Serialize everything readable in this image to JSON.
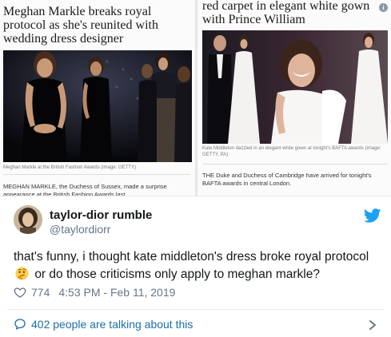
{
  "news": {
    "left": {
      "headline": "Meghan Markle breaks royal protocol as she's reunited with wedding dress designer",
      "caption": "Meghan Markle at the British Fashion Awards (image: GETTY)",
      "snippet": "MEGHAN MARKLE, the Duchess of Sussex, made a surprise appearance at the British Fashion Awards last"
    },
    "right": {
      "headline": "red carpet in elegant white gown with Prince William",
      "caption": "Kate Middleton dazzled in an elegant white gown at tonight's BAFTA awards (image: GETTY, PA)",
      "snippet": "THE Duke and Duchess of Cambridge have arrived for tonight's BAFTA awards in central London."
    },
    "info_icon": "info-icon"
  },
  "tweet": {
    "display_name": "taylor-dior rumble",
    "handle": "@taylordiorr",
    "text_before_emoji": "that's funny, i thought kate middleton's dress broke royal protocol",
    "emoji": "thinking-face",
    "text_after_emoji": "or do those criticisms only apply to meghan markle?",
    "like_count": "774",
    "timestamp": "4:53 PM - Feb 11, 2019",
    "talking_text": "402 people are talking about this",
    "icons": {
      "platform": "twitter-bird-icon",
      "like": "heart-icon",
      "replies": "speech-bubble-icon",
      "more": "chevron-right-icon"
    },
    "colors": {
      "text": "#14171a",
      "muted": "#657786",
      "brand": "#1da1f2",
      "link": "#1b6ea8"
    }
  }
}
